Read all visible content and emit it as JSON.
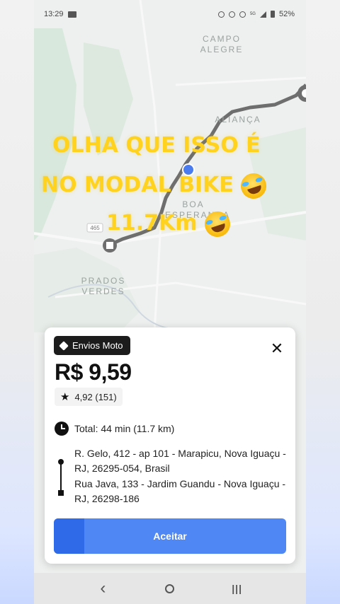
{
  "status_bar": {
    "time": "13:29",
    "network": "5G",
    "battery": "52%"
  },
  "map": {
    "labels": {
      "campo_alegre": "CAMPO\nALEGRE",
      "alianca": "ALIANÇA",
      "boa_esperanca": "BOA\nESPERANÇA",
      "prados_verdes": "PRADOS\nVERDES"
    },
    "colors": {
      "route": "#6e6e6e",
      "current_position": "#4a7cf0"
    }
  },
  "overlay": {
    "line1": "OLHA QUE ISSO É",
    "line2": "NO MODAL BIKE",
    "line3": "11.7Km",
    "emoji": "rolling-on-floor-laughing"
  },
  "offer": {
    "service_badge": "Envios Moto",
    "price": "R$ 9,59",
    "rating": "4,92 (151)",
    "total": "Total: 44 min (11.7 km)",
    "pickup_address": "R. Gelo, 412 - ap 101 - Marapicu, Nova Iguaçu - RJ, 26295-054, Brasil",
    "dropoff_address": "Rua Java, 133 - Jardim Guandu - Nova Iguaçu - RJ, 26298-186",
    "accept_label": "Aceitar",
    "accept_progress": 0.13,
    "accent_color": "#4f87f5"
  },
  "nav": {
    "back": "‹",
    "recents": "|||"
  }
}
